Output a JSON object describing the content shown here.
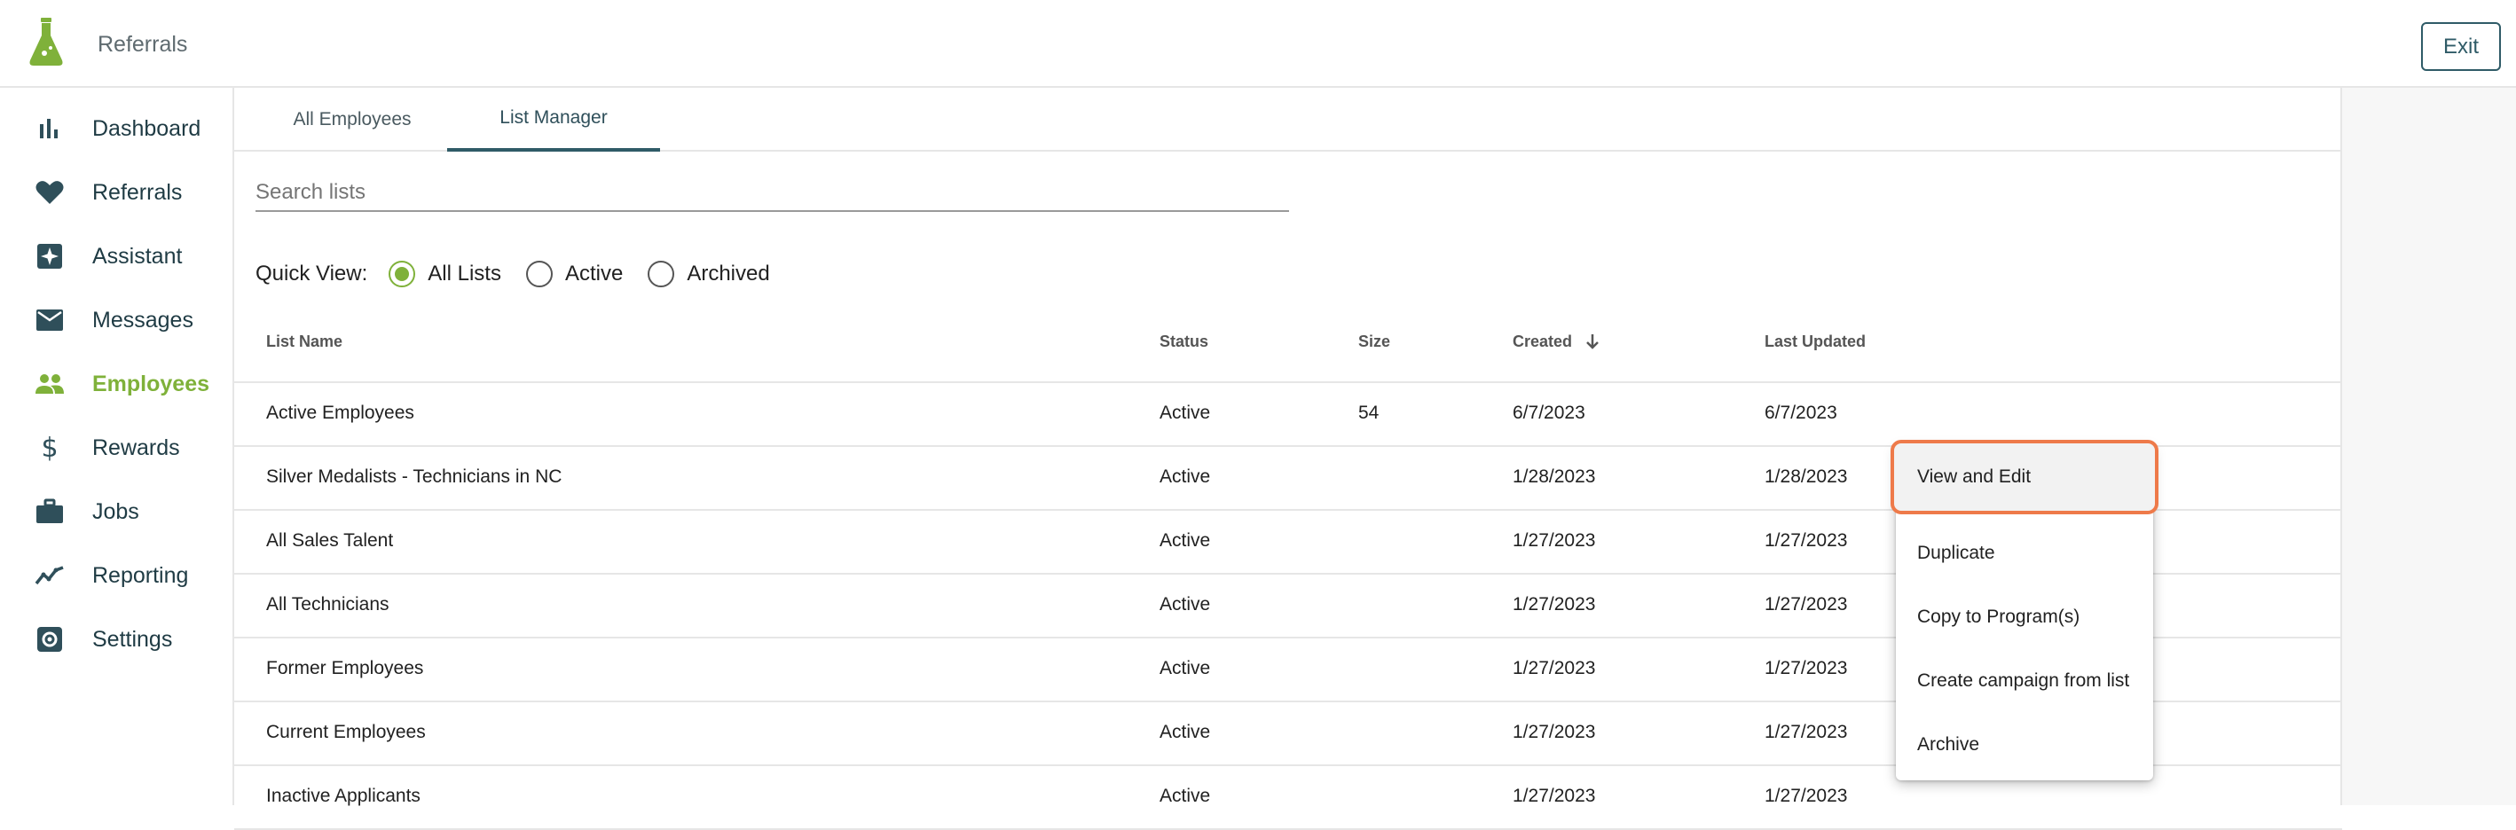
{
  "app": {
    "title": "Referrals",
    "exit_label": "Exit"
  },
  "sidebar": {
    "items": [
      {
        "label": "Dashboard",
        "icon": "bar-chart-icon"
      },
      {
        "label": "Referrals",
        "icon": "heart-icon"
      },
      {
        "label": "Assistant",
        "icon": "sparkle-icon"
      },
      {
        "label": "Messages",
        "icon": "mail-icon"
      },
      {
        "label": "Employees",
        "icon": "people-icon",
        "active": true
      },
      {
        "label": "Rewards",
        "icon": "dollar-icon"
      },
      {
        "label": "Jobs",
        "icon": "briefcase-icon"
      },
      {
        "label": "Reporting",
        "icon": "trend-icon"
      },
      {
        "label": "Settings",
        "icon": "gear-icon"
      }
    ]
  },
  "tabs": [
    {
      "label": "All Employees",
      "selected": false
    },
    {
      "label": "List Manager",
      "selected": true
    }
  ],
  "search": {
    "placeholder": "Search lists",
    "value": ""
  },
  "quick_view": {
    "label": "Quick View:",
    "options": [
      "All Lists",
      "Active",
      "Archived"
    ],
    "selected": "All Lists"
  },
  "table": {
    "columns": [
      "List Name",
      "Status",
      "Size",
      "Created",
      "Last Updated"
    ],
    "sorted_by": "Created",
    "rows": [
      {
        "name": "Active Employees",
        "status": "Active",
        "size": "54",
        "created": "6/7/2023",
        "updated": "6/7/2023"
      },
      {
        "name": "Silver Medalists - Technicians in NC",
        "status": "Active",
        "size": "",
        "created": "1/28/2023",
        "updated": "1/28/2023"
      },
      {
        "name": "All Sales Talent",
        "status": "Active",
        "size": "",
        "created": "1/27/2023",
        "updated": "1/27/2023"
      },
      {
        "name": "All Technicians",
        "status": "Active",
        "size": "",
        "created": "1/27/2023",
        "updated": "1/27/2023"
      },
      {
        "name": "Former Employees",
        "status": "Active",
        "size": "",
        "created": "1/27/2023",
        "updated": "1/27/2023"
      },
      {
        "name": "Current Employees",
        "status": "Active",
        "size": "",
        "created": "1/27/2023",
        "updated": "1/27/2023"
      },
      {
        "name": "Inactive Applicants",
        "status": "Active",
        "size": "",
        "created": "1/27/2023",
        "updated": "1/27/2023"
      }
    ]
  },
  "context_menu": {
    "items": [
      "View and Edit",
      "Duplicate",
      "Copy to Program(s)",
      "Create campaign from list",
      "Archive"
    ],
    "highlighted": "View and Edit"
  },
  "colors": {
    "brand_green": "#7fb13a",
    "primary_teal": "#2f5b67",
    "highlight_orange": "#ee7a4a"
  }
}
